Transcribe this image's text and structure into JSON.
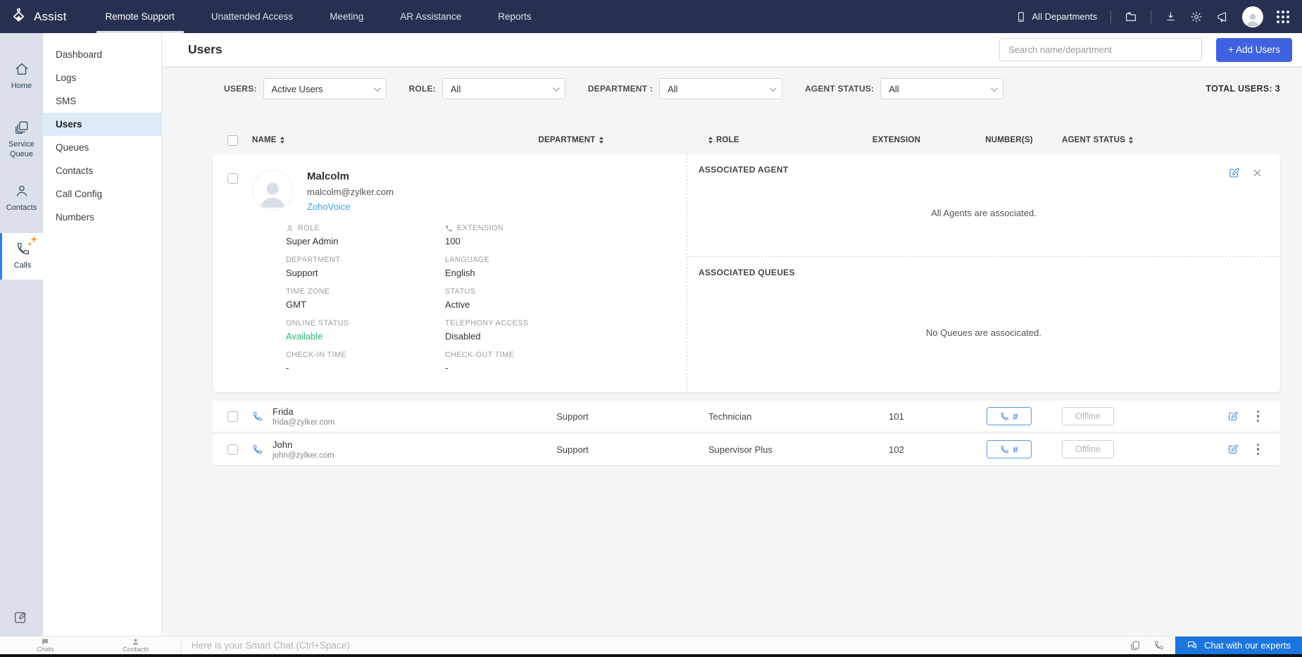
{
  "colors": {
    "nav_bg": "#273050",
    "accent_blue": "#3f63e0",
    "link_blue": "#3ba3ef",
    "icon_blue": "#4a90e2",
    "available_green": "#27b779",
    "experts_button_blue": "#1b76df",
    "rail_active_border": "#2f80ed"
  },
  "topnav": {
    "brand": "Assist",
    "tabs": [
      {
        "label": "Remote Support",
        "active": true
      },
      {
        "label": "Unattended Access",
        "active": false
      },
      {
        "label": "Meeting",
        "active": false
      },
      {
        "label": "AR Assistance",
        "active": false
      },
      {
        "label": "Reports",
        "active": false
      }
    ],
    "departments_label": "All Departments"
  },
  "rail": {
    "items": [
      {
        "label": "Home"
      },
      {
        "label": "Service Queue"
      },
      {
        "label": "Contacts"
      },
      {
        "label": "Calls"
      }
    ]
  },
  "subnav": {
    "items": [
      {
        "label": "Dashboard"
      },
      {
        "label": "Logs"
      },
      {
        "label": "SMS"
      },
      {
        "label": "Users"
      },
      {
        "label": "Queues"
      },
      {
        "label": "Contacts"
      },
      {
        "label": "Call Config"
      },
      {
        "label": "Numbers"
      }
    ]
  },
  "page": {
    "title": "Users",
    "search_placeholder": "Search name/department",
    "add_users_label": "+ Add Users",
    "total_users": "TOTAL USERS: 3"
  },
  "filters": [
    {
      "label": "USERS:",
      "value": "Active Users"
    },
    {
      "label": "ROLE:",
      "value": "All"
    },
    {
      "label": "DEPARTMENT :",
      "value": "All"
    },
    {
      "label": "AGENT STATUS:",
      "value": "All"
    }
  ],
  "table": {
    "headers": {
      "name": "NAME",
      "department": "DEPARTMENT",
      "role": "ROLE",
      "extension": "EXTENSION",
      "numbers": "NUMBER(S)",
      "agent_status": "AGENT STATUS"
    }
  },
  "expanded_user": {
    "name": "Malcolm",
    "email": "malcolm@zylker.com",
    "link": "ZohoVoice",
    "details": [
      {
        "label": "ROLE",
        "value": "Super Admin"
      },
      {
        "label": "EXTENSION",
        "value": "100"
      },
      {
        "label": "DEPARTMENT",
        "value": "Support"
      },
      {
        "label": "LANGUAGE",
        "value": "English"
      },
      {
        "label": "TIME ZONE",
        "value": "GMT"
      },
      {
        "label": "STATUS",
        "value": "Active"
      },
      {
        "label": "ONLINE STATUS",
        "value": "Available"
      },
      {
        "label": "TELEPHONY ACCESS",
        "value": "Disabled"
      },
      {
        "label": "CHECK-IN TIME",
        "value": "-"
      },
      {
        "label": "CHECK-OUT TIME",
        "value": "-"
      }
    ],
    "associated_agent": {
      "title": "ASSOCIATED AGENT",
      "message": "All Agents are associated."
    },
    "associated_queues": {
      "title": "ASSOCIATED QUEUES",
      "message": "No Queues are associcated."
    }
  },
  "rows": [
    {
      "name": "Frida",
      "email": "frida@zylker.com",
      "department": "Support",
      "role": "Technician",
      "extension": "101",
      "agent_status": "Offline"
    },
    {
      "name": "John",
      "email": "john@zylker.com",
      "department": "Support",
      "role": "Supervisor Plus",
      "extension": "102",
      "agent_status": "Offline"
    }
  ],
  "ui": {
    "number_button_hash": "#"
  },
  "chatbar": {
    "chats_label": "Chats",
    "contacts_label": "Contacts",
    "input_placeholder": "Here is your Smart Chat (Ctrl+Space)",
    "experts_label": "Chat with our experts"
  }
}
